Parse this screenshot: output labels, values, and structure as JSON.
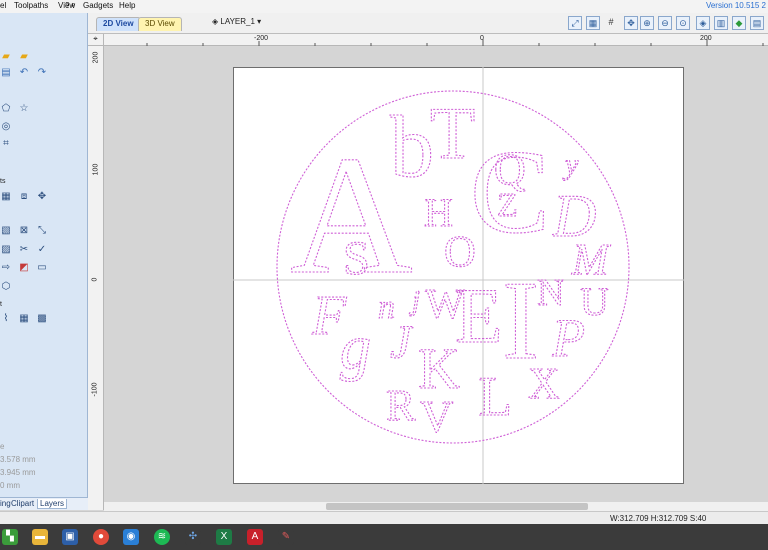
{
  "menubar": {
    "items": [
      "el",
      "Toolpaths",
      "View",
      "Gadgets",
      "Help"
    ],
    "panel_controls": "? ᵖ",
    "version": "Version 10.515 2"
  },
  "view_tabs": {
    "tab_2d": "2D View",
    "tab_3d": "3D View",
    "layer": "LAYER_1 ▾"
  },
  "rulers": {
    "top": [
      "-200",
      "0",
      "200"
    ],
    "left": [
      "200",
      "100",
      "0",
      "-100"
    ]
  },
  "left_panel": {
    "section_1": "ts",
    "section_2": "t",
    "dims": [
      "e",
      "3.578 mm",
      "3.945 mm",
      "0 mm"
    ],
    "tabs": [
      "ing",
      "Clipart",
      "Layers"
    ]
  },
  "design_letters": {
    "upright": [
      "A",
      "b",
      "T",
      "C",
      "Q",
      "Z",
      "H",
      "S",
      "O",
      "W",
      "E",
      "I",
      "N",
      "U",
      "K",
      "L",
      "X",
      "R",
      "V"
    ],
    "italic": [
      "y",
      "D",
      "M",
      "F",
      "n",
      "j",
      "g",
      "J",
      "P"
    ]
  },
  "status": {
    "dims": "W:312.709  H:312.709  S:40"
  },
  "colors": {
    "vector": "#cf5fd6",
    "panel": "#d9e6f5",
    "material": "#ffffff"
  },
  "taskbar_icons": [
    "windows-icon",
    "folder-icon",
    "vcarve-icon",
    "chrome-icon",
    "app-icon",
    "spotify-icon",
    "network-icon",
    "excel-icon",
    "pdf-icon",
    "tool-icon"
  ]
}
